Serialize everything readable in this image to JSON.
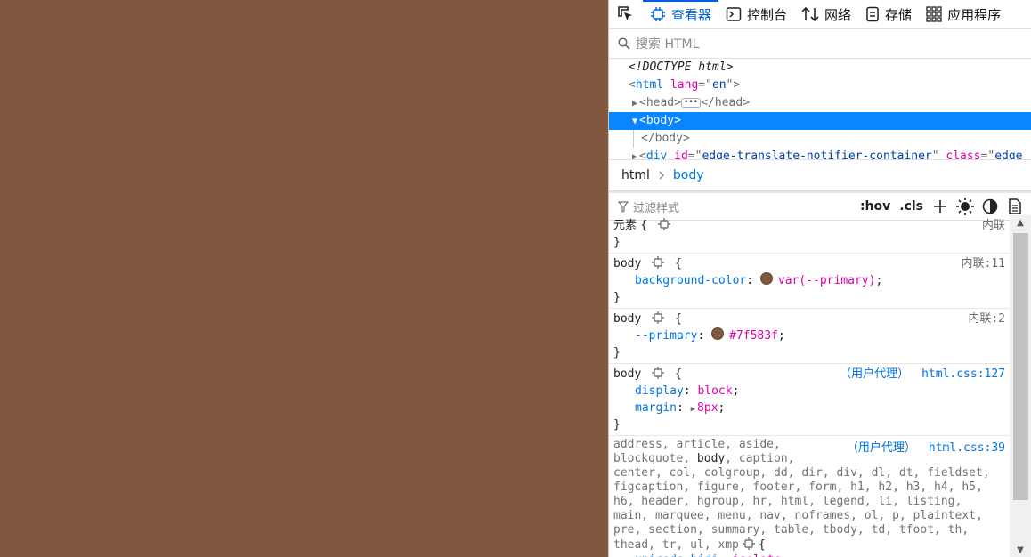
{
  "page": {
    "background": "#7f583f"
  },
  "toolbar": {
    "tabs": [
      {
        "label": "查看器",
        "icon": "inspector-icon",
        "active": true
      },
      {
        "label": "控制台",
        "icon": "console-icon"
      },
      {
        "label": "网络",
        "icon": "network-icon"
      },
      {
        "label": "存储",
        "icon": "storage-icon"
      },
      {
        "label": "应用程序",
        "icon": "application-icon"
      }
    ]
  },
  "search": {
    "placeholder": "搜索 HTML"
  },
  "markup": {
    "doctype": "<!DOCTYPE html>",
    "html_open_tag": "html",
    "html_attr_name": "lang",
    "html_attr_value": "en",
    "head_open": "<head>",
    "head_close": "</head>",
    "body_open": "<body>",
    "body_close": "</body>",
    "div_tag": "div",
    "div_id_attr": "id",
    "div_id_value": "edge-translate-notifier-container",
    "div_class_attr": "class",
    "div_class_value": "edge"
  },
  "breadcrumb": {
    "items": [
      "html",
      "body"
    ]
  },
  "rules_toolbar": {
    "filter_placeholder": "过滤样式",
    "hov": ":hov",
    "cls": ".cls"
  },
  "rules": {
    "element": {
      "selector": "元素 {",
      "source": "内联",
      "close": "}"
    },
    "body1": {
      "selector": "body",
      "source": "内联:11",
      "prop": "background-color",
      "value": "var(--primary)",
      "swatch": "#7f583f"
    },
    "body2": {
      "selector": "body",
      "source": "内联:2",
      "prop": "--primary",
      "value": "#7f583f",
      "swatch": "#7f583f"
    },
    "body3": {
      "selector": "body",
      "origin": "（用户代理）",
      "source": "html.css:127",
      "prop1": "display",
      "value1": "block",
      "prop2": "margin",
      "value2": "8px"
    },
    "block": {
      "origin": "（用户代理）",
      "source": "html.css:39",
      "lines": [
        "address, article, aside,",
        "blockquote, body, caption,",
        "center, col, colgroup, dd, dir, div, dl, dt, fieldset,",
        "figcaption, figure, footer, form, h1, h2, h3, h4, h5,",
        "h6, header, hgroup, hr, html, legend, li, listing,",
        "main, marquee, menu, nav, noframes, ol, p, plaintext,",
        "pre, section, summary, table, tbody, td, tfoot, th,",
        "thead, tr, ul, xmp"
      ],
      "prop": "unicode-bidi",
      "value": "isolate"
    }
  }
}
